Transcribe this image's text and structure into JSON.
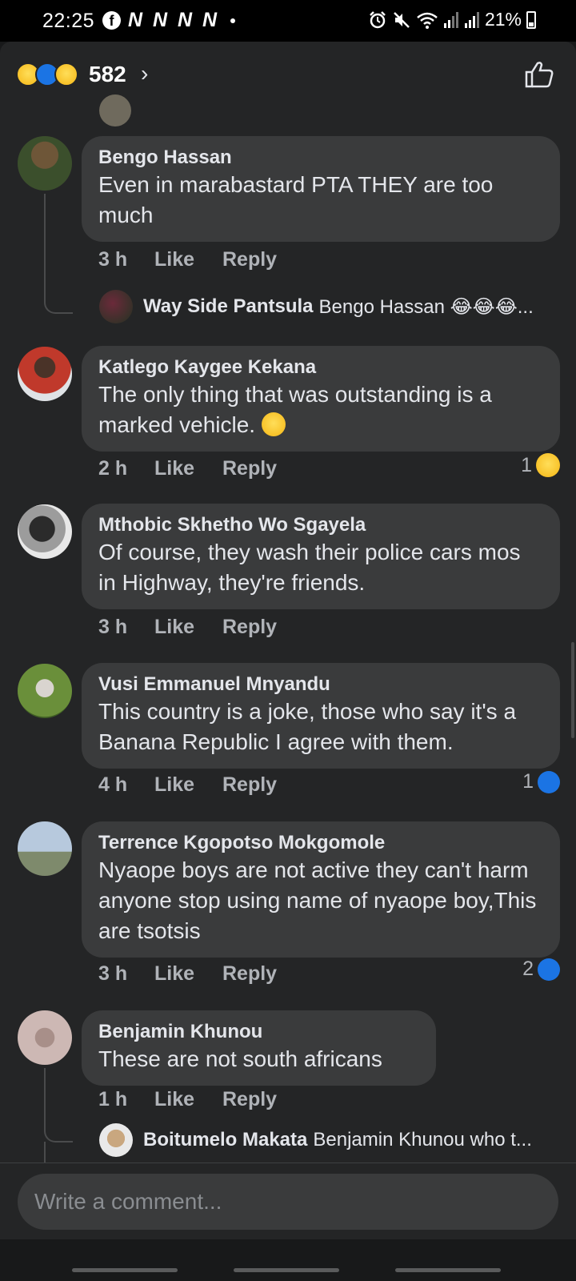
{
  "status_bar": {
    "time": "22:25",
    "notification_letters": [
      "N",
      "N",
      "N",
      "N"
    ],
    "battery": "21%"
  },
  "reactions_header": {
    "count": "582",
    "reaction_types": [
      "haha",
      "like",
      "wow"
    ]
  },
  "comments": [
    {
      "author": "Bengo Hassan",
      "text": "Even in marabastard PTA THEY are too much",
      "time": "3 h",
      "like_label": "Like",
      "reply_label": "Reply",
      "reply_preview": {
        "name": "Way Side Pantsula",
        "text": "Bengo Hassan 😂😂😂..."
      }
    },
    {
      "author": "Katlego Kaygee Kekana",
      "text": "The only thing that was outstanding is a marked vehicle.",
      "time": "2 h",
      "like_label": "Like",
      "reply_label": "Reply",
      "reaction_count": "1",
      "reaction_type": "haha"
    },
    {
      "author": "Mthobic Skhetho Wo Sgayela",
      "text": "Of course, they wash their police cars mos in Highway, they're friends.",
      "time": "3 h",
      "like_label": "Like",
      "reply_label": "Reply"
    },
    {
      "author": "Vusi Emmanuel Mnyandu",
      "text": "This country is a joke, those who say it's a Banana Republic I agree with them.",
      "time": "4 h",
      "like_label": "Like",
      "reply_label": "Reply",
      "reaction_count": "1",
      "reaction_type": "like"
    },
    {
      "author": "Terrence Kgopotso Mokgomole",
      "text": "Nyaope boys are not active they can't harm anyone stop using name of nyaope boy,This are tsotsis",
      "time": "3 h",
      "like_label": "Like",
      "reply_label": "Reply",
      "reaction_count": "2",
      "reaction_type": "like"
    },
    {
      "author": "Benjamin Khunou",
      "text": "These are not  south africans",
      "time": "1 h",
      "like_label": "Like",
      "reply_label": "Reply",
      "reply_preview": {
        "name": "Boitumelo Makata",
        "text": "Benjamin Khunou who t..."
      }
    }
  ],
  "composer": {
    "placeholder": "Write a comment..."
  },
  "colors": {
    "background": "#242526",
    "bubble": "#3a3b3c",
    "like_blue": "#1b74e4",
    "meta_text": "#b0b3b8"
  }
}
